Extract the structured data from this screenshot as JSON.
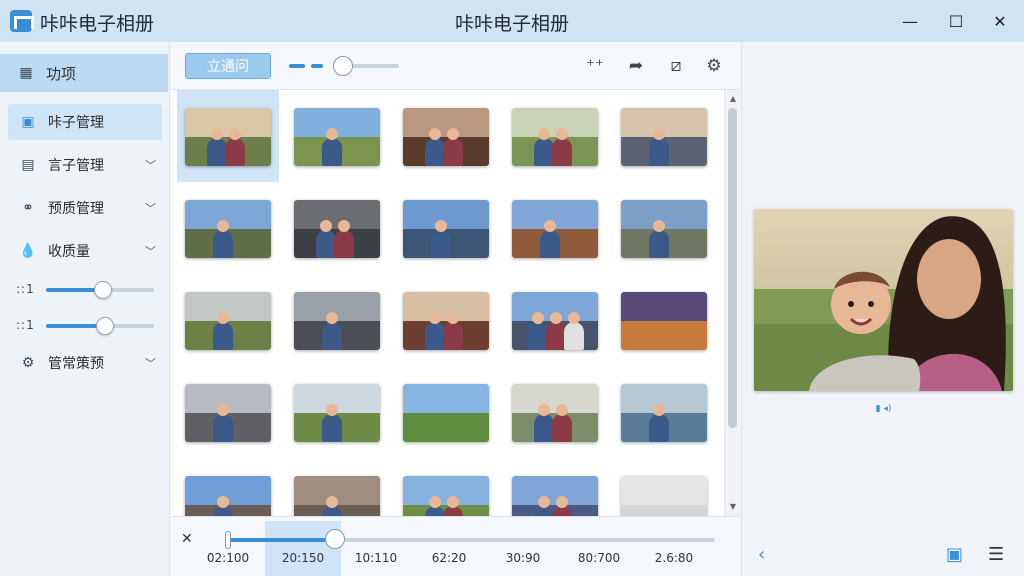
{
  "titlebar": {
    "app_name": "咔咔电子相册",
    "window_title": "咔咔电子相册",
    "minimize": "—",
    "maximize": "☐",
    "close": "✕"
  },
  "sidebar": {
    "head_label": "功项",
    "items": [
      {
        "label": "咔子管理",
        "icon": "album-icon",
        "active": true
      },
      {
        "label": "言子管理",
        "icon": "folder-icon",
        "chevron": true
      },
      {
        "label": "预质管理",
        "icon": "nodes-icon",
        "chevron": true
      },
      {
        "label": "收质量",
        "icon": "drop-icon",
        "chevron": true
      },
      {
        "label": "管常策预",
        "icon": "gear-icon",
        "chevron": true
      }
    ],
    "sliders": [
      {
        "icon": "::1",
        "level": 0.52
      },
      {
        "icon": "::1",
        "level": 0.54
      }
    ]
  },
  "toolbar": {
    "primary_button": "立通问",
    "zoom_level": 0.5,
    "icons": [
      "sparkle-add-icon",
      "share-icon",
      "edit-frame-icon",
      "settings-icon"
    ]
  },
  "gallery": {
    "columns": 5,
    "selected_index": 0,
    "photos": [
      {
        "scene": "mother-daughter",
        "sky": "#d9c7a8",
        "ground": "#6c7f4a",
        "figs": 2
      },
      {
        "scene": "field-couple",
        "sky": "#7fb0dd",
        "ground": "#7d9450",
        "figs": 1
      },
      {
        "scene": "porch-couple",
        "sky": "#b89880",
        "ground": "#5a3c2d",
        "figs": 2
      },
      {
        "scene": "mother-child",
        "sky": "#c9d3b8",
        "ground": "#7a9654",
        "figs": 2
      },
      {
        "scene": "boy-interior",
        "sky": "#d8c4ad",
        "ground": "#5b6373",
        "figs": 1
      },
      {
        "scene": "road-walker",
        "sky": "#7ba6d6",
        "ground": "#5f6e45",
        "figs": 1
      },
      {
        "scene": "couple-dusk",
        "sky": "#6a6e73",
        "ground": "#3c3f44",
        "figs": 2
      },
      {
        "scene": "pier-man",
        "sky": "#6d9ad1",
        "ground": "#3e5675",
        "figs": 1
      },
      {
        "scene": "path-child",
        "sky": "#81a7d8",
        "ground": "#8f5b3a",
        "figs": 1
      },
      {
        "scene": "road-fence",
        "sky": "#7c9fc8",
        "ground": "#6f7862",
        "figs": 1
      },
      {
        "scene": "porch-field",
        "sky": "#c4c8c4",
        "ground": "#6d8146",
        "figs": 1
      },
      {
        "scene": "hallway",
        "sky": "#9aa0a8",
        "ground": "#4b4e55",
        "figs": 1
      },
      {
        "scene": "dining-room",
        "sky": "#d6bea2",
        "ground": "#6d3f33",
        "figs": 2
      },
      {
        "scene": "selfie-group",
        "sky": "#7fa6d8",
        "ground": "#46536a",
        "figs": 3
      },
      {
        "scene": "sunset-porch",
        "sky": "#5a4a7a",
        "ground": "#c67b3d",
        "figs": 0
      },
      {
        "scene": "road-car",
        "sky": "#b8bcc2",
        "ground": "#5e6066",
        "figs": 1
      },
      {
        "scene": "field-woman",
        "sky": "#cfd7df",
        "ground": "#6d8a47",
        "figs": 1
      },
      {
        "scene": "house-lawn",
        "sky": "#86b5e1",
        "ground": "#5f8c3f",
        "figs": 0
      },
      {
        "scene": "family-pair",
        "sky": "#d7d7cf",
        "ground": "#7b8d6a",
        "figs": 2
      },
      {
        "scene": "woman-lake",
        "sky": "#b6c7d4",
        "ground": "#5a7b9a",
        "figs": 1
      },
      {
        "scene": "city-wall",
        "sky": "#6f9ed8",
        "ground": "#6b5d55",
        "figs": 1
      },
      {
        "scene": "arcade-walk",
        "sky": "#9f8e80",
        "ground": "#6b5f55",
        "figs": 1
      },
      {
        "scene": "field-pair",
        "sky": "#86b0dd",
        "ground": "#6d8f45",
        "figs": 2
      },
      {
        "scene": "mom-kid",
        "sky": "#7ea5d6",
        "ground": "#4a5c86",
        "figs": 2
      },
      {
        "scene": "white-flower",
        "sky": "#e6e6e6",
        "ground": "#d6d6d6",
        "figs": 0
      }
    ]
  },
  "timeline": {
    "close": "✕",
    "labels": [
      "02:100",
      "20:150",
      "10:110",
      "62:20",
      "30:90",
      "80:700",
      "2.6:80"
    ],
    "active_index": 1,
    "progress": 0.22
  },
  "preview": {
    "caption": "▮ ◂)",
    "back_icon": "‹",
    "slideshow_icon": "▣",
    "list_icon": "☰",
    "sky": "#d8c6a8",
    "ground": "#7c9a52"
  }
}
